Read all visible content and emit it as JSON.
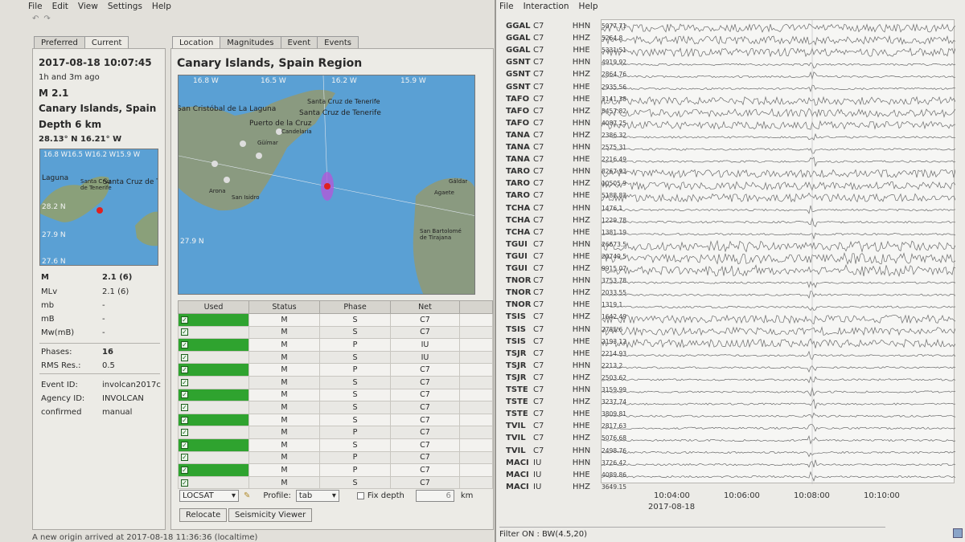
{
  "left_window": {
    "menu": [
      "File",
      "Edit",
      "View",
      "Settings",
      "Help"
    ],
    "side_tabs": [
      "Preferred",
      "Current"
    ],
    "main_tabs": [
      "Location",
      "Magnitudes",
      "Event",
      "Events"
    ],
    "origin_time": "2017-08-18 10:07:45",
    "ago": "1h and 3m ago",
    "magnitude": "M 2.1",
    "region_short": "Canary Islands, Spain",
    "depth": "Depth  6 km",
    "coords": "28.13° N  16.21° W",
    "small_map": {
      "lon_labels": "16.8 W16.5 W16.2 W15.9 W",
      "lat_labels": [
        "28.2 N",
        "27.9 N",
        "27.6 N"
      ],
      "places": [
        "Laguna",
        "Santa Cruz de Tenerife",
        "Santa Cruz de T"
      ]
    },
    "mag_rows": [
      {
        "k": "M",
        "v": "2.1 (6)"
      },
      {
        "k": "MLv",
        "v": "2.1 (6)"
      },
      {
        "k": "mb",
        "v": "-"
      },
      {
        "k": "mB",
        "v": "-"
      },
      {
        "k": "Mw(mB)",
        "v": "-"
      }
    ],
    "phases_label": "Phases:",
    "phases_value": "16",
    "rms_label": "RMS Res.:",
    "rms_value": "0.5",
    "event_id_label": "Event ID:",
    "event_id": "involcan2017c",
    "agency_label": "Agency ID:",
    "agency": "INVOLCAN",
    "status_label": "confirmed",
    "status_value": "manual",
    "region_title": "Canary Islands, Spain Region",
    "big_map": {
      "lon_labels": [
        "16.8 W",
        "16.5 W",
        "16.2 W",
        "15.9 W"
      ],
      "lat_labels": [
        "27.9 N"
      ],
      "places": [
        "San Cristóbal de La Laguna",
        "Santa Cruz de Tenerife",
        "Santa Cruz de Tenerife",
        "Puerto de la Cruz",
        "Güímar",
        "Arona",
        "San Isidro",
        "Agaete",
        "Gáldar",
        "Candelaria",
        "San Bartolomé de Tirajana"
      ]
    },
    "table_headers": [
      "Used",
      "Status",
      "Phase",
      "Net"
    ],
    "phase_rows": [
      {
        "status": "M",
        "phase": "S",
        "net": "C7"
      },
      {
        "status": "M",
        "phase": "S",
        "net": "C7"
      },
      {
        "status": "M",
        "phase": "P",
        "net": "IU"
      },
      {
        "status": "M",
        "phase": "S",
        "net": "IU"
      },
      {
        "status": "M",
        "phase": "P",
        "net": "C7"
      },
      {
        "status": "M",
        "phase": "S",
        "net": "C7"
      },
      {
        "status": "M",
        "phase": "S",
        "net": "C7"
      },
      {
        "status": "M",
        "phase": "S",
        "net": "C7"
      },
      {
        "status": "M",
        "phase": "S",
        "net": "C7"
      },
      {
        "status": "M",
        "phase": "P",
        "net": "C7"
      },
      {
        "status": "M",
        "phase": "S",
        "net": "C7"
      },
      {
        "status": "M",
        "phase": "P",
        "net": "C7"
      },
      {
        "status": "M",
        "phase": "P",
        "net": "C7"
      },
      {
        "status": "M",
        "phase": "S",
        "net": "C7"
      }
    ],
    "locator": "LOCSAT",
    "profile_label": "Profile:",
    "profile_value": "tab",
    "fix_depth_label": "Fix depth",
    "fix_depth_value": "6",
    "km": "km",
    "relocate": "Relocate",
    "seismicity_viewer": "Seismicity Viewer",
    "status_message": "A new origin arrived at 2017-08-18 11:36:36 (localtime)"
  },
  "right_window": {
    "menu": [
      "File",
      "Interaction",
      "Help"
    ],
    "traces": [
      {
        "sta": "GGAL",
        "net": "C7",
        "cha": "HHN",
        "amp": "5077.71"
      },
      {
        "sta": "GGAL",
        "net": "C7",
        "cha": "HHZ",
        "amp": "5264.8"
      },
      {
        "sta": "GGAL",
        "net": "C7",
        "cha": "HHE",
        "amp": "5331.51"
      },
      {
        "sta": "GSNT",
        "net": "C7",
        "cha": "HHN",
        "amp": "4919.92"
      },
      {
        "sta": "GSNT",
        "net": "C7",
        "cha": "HHZ",
        "amp": "2864.76"
      },
      {
        "sta": "GSNT",
        "net": "C7",
        "cha": "HHE",
        "amp": "2935.56"
      },
      {
        "sta": "TAFO",
        "net": "C7",
        "cha": "HHE",
        "amp": "3141.38"
      },
      {
        "sta": "TAFO",
        "net": "C7",
        "cha": "HHZ",
        "amp": "5457.82"
      },
      {
        "sta": "TAFO",
        "net": "C7",
        "cha": "HHN",
        "amp": "4087.25"
      },
      {
        "sta": "TANA",
        "net": "C7",
        "cha": "HHZ",
        "amp": "2386.32"
      },
      {
        "sta": "TANA",
        "net": "C7",
        "cha": "HHN",
        "amp": "2575.31"
      },
      {
        "sta": "TANA",
        "net": "C7",
        "cha": "HHE",
        "amp": "2216.49"
      },
      {
        "sta": "TARO",
        "net": "C7",
        "cha": "HHN",
        "amp": "8267.93"
      },
      {
        "sta": "TARO",
        "net": "C7",
        "cha": "HHZ",
        "amp": "10505.9"
      },
      {
        "sta": "TARO",
        "net": "C7",
        "cha": "HHE",
        "amp": "5188.83"
      },
      {
        "sta": "TCHA",
        "net": "C7",
        "cha": "HHN",
        "amp": "1476.1"
      },
      {
        "sta": "TCHA",
        "net": "C7",
        "cha": "HHZ",
        "amp": "1229.78"
      },
      {
        "sta": "TCHA",
        "net": "C7",
        "cha": "HHE",
        "amp": "1381.19"
      },
      {
        "sta": "TGUI",
        "net": "C7",
        "cha": "HHN",
        "amp": "26673.5"
      },
      {
        "sta": "TGUI",
        "net": "C7",
        "cha": "HHE",
        "amp": "20749.5"
      },
      {
        "sta": "TGUI",
        "net": "C7",
        "cha": "HHZ",
        "amp": "9915.07"
      },
      {
        "sta": "TNOR",
        "net": "C7",
        "cha": "HHN",
        "amp": "3753.78"
      },
      {
        "sta": "TNOR",
        "net": "C7",
        "cha": "HHZ",
        "amp": "2033.55"
      },
      {
        "sta": "TNOR",
        "net": "C7",
        "cha": "HHE",
        "amp": "1319.1"
      },
      {
        "sta": "TSIS",
        "net": "C7",
        "cha": "HHZ",
        "amp": "1642.49"
      },
      {
        "sta": "TSIS",
        "net": "C7",
        "cha": "HHN",
        "amp": "2785.6"
      },
      {
        "sta": "TSIS",
        "net": "C7",
        "cha": "HHE",
        "amp": "2193.12"
      },
      {
        "sta": "TSJR",
        "net": "C7",
        "cha": "HHE",
        "amp": "2214.93"
      },
      {
        "sta": "TSJR",
        "net": "C7",
        "cha": "HHN",
        "amp": "2213.2"
      },
      {
        "sta": "TSJR",
        "net": "C7",
        "cha": "HHZ",
        "amp": "2503.62"
      },
      {
        "sta": "TSTE",
        "net": "C7",
        "cha": "HHN",
        "amp": "3159.99"
      },
      {
        "sta": "TSTE",
        "net": "C7",
        "cha": "HHZ",
        "amp": "3237.74"
      },
      {
        "sta": "TSTE",
        "net": "C7",
        "cha": "HHE",
        "amp": "3809.81"
      },
      {
        "sta": "TVIL",
        "net": "C7",
        "cha": "HHE",
        "amp": "2817.63"
      },
      {
        "sta": "TVIL",
        "net": "C7",
        "cha": "HHZ",
        "amp": "5076.68"
      },
      {
        "sta": "TVIL",
        "net": "C7",
        "cha": "HHN",
        "amp": "2498.76"
      },
      {
        "sta": "MACI",
        "net": "IU",
        "cha": "HHN",
        "amp": "3726.42"
      },
      {
        "sta": "MACI",
        "net": "IU",
        "cha": "HHE",
        "amp": "4089.86"
      },
      {
        "sta": "MACI",
        "net": "IU",
        "cha": "HHZ",
        "amp": "3649.15"
      }
    ],
    "time_ticks": [
      "10:04:00",
      "10:06:00",
      "10:08:00",
      "10:10:00"
    ],
    "date_label": "2017-08-18",
    "filter_status": "Filter ON : BW(4.5,20)"
  }
}
